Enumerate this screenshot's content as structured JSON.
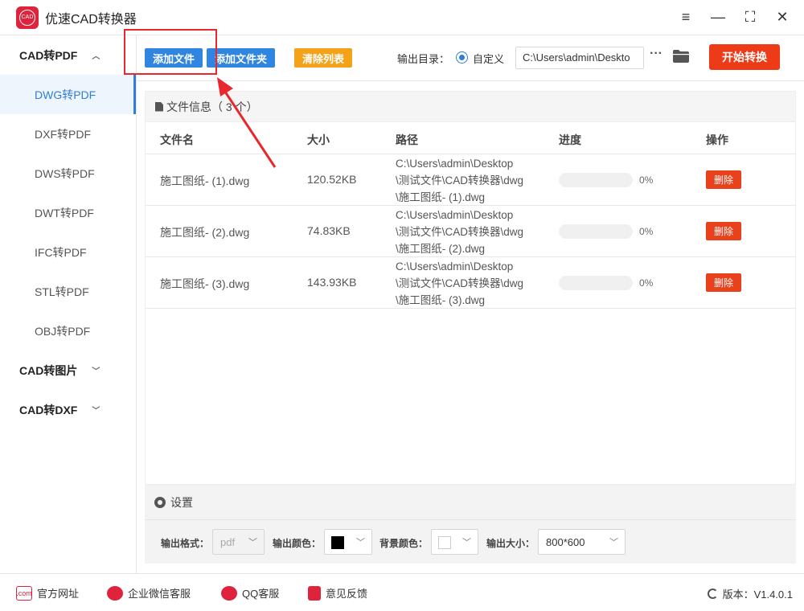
{
  "app": {
    "title": "优速CAD转换器",
    "logo_text": "CAD"
  },
  "sidebar": {
    "groups": [
      {
        "label": "CAD转PDF",
        "expanded": true,
        "items": [
          "DWG转PDF",
          "DXF转PDF",
          "DWS转PDF",
          "DWT转PDF",
          "IFC转PDF",
          "STL转PDF",
          "OBJ转PDF"
        ],
        "active": "DWG转PDF"
      },
      {
        "label": "CAD转图片",
        "expanded": false
      },
      {
        "label": "CAD转DXF",
        "expanded": false
      }
    ]
  },
  "toolbar": {
    "add_file": "添加文件",
    "add_folder": "添加文件夹",
    "clear_list": "清除列表",
    "output_dir_label": "输出目录：",
    "custom_label": "自定义",
    "output_path": "C:\\Users\\admin\\Deskto",
    "more": "···",
    "start": "开始转换"
  },
  "file_panel": {
    "title": "文件信息（ 3 个）",
    "columns": {
      "name": "文件名",
      "size": "大小",
      "path": "路径",
      "progress": "进度",
      "action": "操作"
    },
    "rows": [
      {
        "name": "施工图纸- (1).dwg",
        "size": "120.52KB",
        "path": [
          "C:\\Users\\admin\\Desktop",
          "\\测试文件\\CAD转换器\\dwg",
          "\\施工图纸- (1).dwg"
        ],
        "progress": 0,
        "progress_text": "0%",
        "delete": "删除"
      },
      {
        "name": "施工图纸- (2).dwg",
        "size": "74.83KB",
        "path": [
          "C:\\Users\\admin\\Desktop",
          "\\测试文件\\CAD转换器\\dwg",
          "\\施工图纸- (2).dwg"
        ],
        "progress": 0,
        "progress_text": "0%",
        "delete": "删除"
      },
      {
        "name": "施工图纸- (3).dwg",
        "size": "143.93KB",
        "path": [
          "C:\\Users\\admin\\Desktop",
          "\\测试文件\\CAD转换器\\dwg",
          "\\施工图纸- (3).dwg"
        ],
        "progress": 0,
        "progress_text": "0%",
        "delete": "删除"
      }
    ]
  },
  "settings": {
    "title": "设置",
    "format_label": "输出格式：",
    "format_value": "pdf",
    "color_label": "输出颜色：",
    "color_value": "#000000",
    "bg_label": "背景颜色：",
    "bg_value": "#ffffff",
    "size_label": "输出大小：",
    "size_value": "800*600"
  },
  "footer": {
    "website": "官方网址",
    "wechat": "企业微信客服",
    "qq": "QQ客服",
    "feedback": "意见反馈",
    "version": "版本：V1.4.0.1"
  },
  "colors": {
    "accent_blue": "#3085e0",
    "danger": "#ec3b16",
    "warning": "#f3a21a",
    "annotation": "#e8272e"
  }
}
